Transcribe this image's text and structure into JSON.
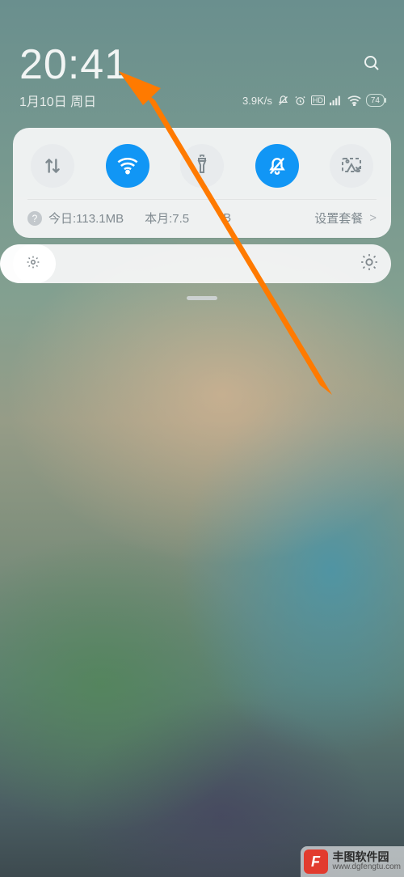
{
  "status": {
    "time": "20:41",
    "date": "1月10日 周日",
    "speed": "3.9K/s",
    "hd": "HD",
    "battery": "74"
  },
  "toggles": {
    "data": {
      "active": false,
      "name": "mobile-data"
    },
    "wifi": {
      "active": true,
      "name": "wifi"
    },
    "flashlight": {
      "active": false,
      "name": "flashlight"
    },
    "dnd": {
      "active": true,
      "name": "do-not-disturb"
    },
    "screenshot": {
      "active": false,
      "name": "screenshot"
    }
  },
  "usage": {
    "today_label": "今日:113.1MB",
    "month_label": "本月:7.5",
    "month_unit": "B",
    "plan_label": "设置套餐",
    "chev": ">"
  },
  "brightness": {
    "level_percent": 8
  },
  "watermark": {
    "badge": "F",
    "title": "丰图软件园",
    "url": "www.dgfengtu.com"
  }
}
